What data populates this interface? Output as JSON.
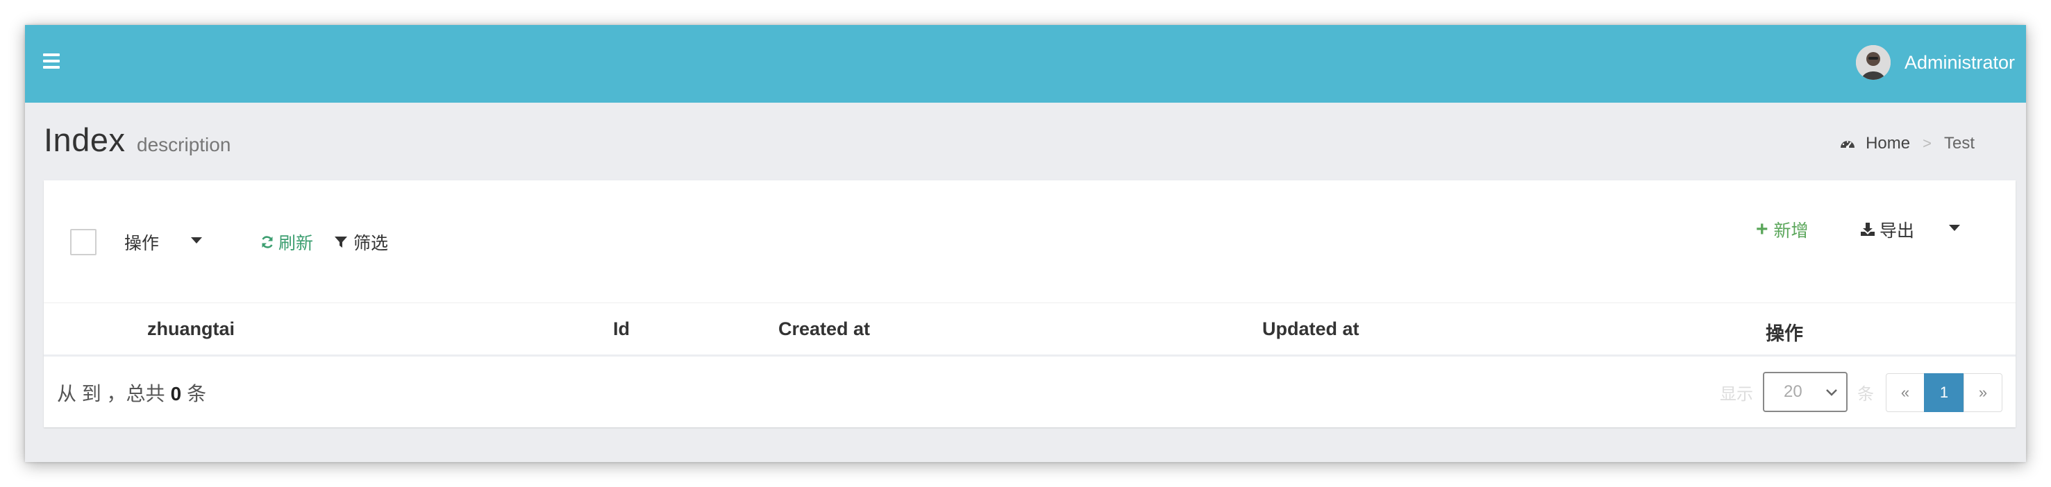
{
  "navbar": {
    "user_name": "Administrator",
    "brand_color": "#4fb8d1"
  },
  "header": {
    "title": "Index",
    "description": "description",
    "breadcrumb": {
      "home_label": "Home",
      "separator": ">",
      "current_label": "Test"
    }
  },
  "toolbar": {
    "action_label": "操作",
    "refresh_label": "刷新",
    "filter_label": "筛选",
    "new_label": "新增",
    "export_label": "导出"
  },
  "table": {
    "columns": [
      "zhuangtai",
      "Id",
      "Created at",
      "Updated at",
      "操作"
    ],
    "rows": []
  },
  "footer": {
    "summary_prefix": "从 到 ，总共",
    "total": "0",
    "summary_suffix": "条",
    "per_page_prefix": "显示",
    "per_page_value": "20",
    "per_page_suffix": "条",
    "pagination": {
      "prev": "«",
      "current": "1",
      "next": "»"
    }
  },
  "colors": {
    "accent_green": "#3c9e70",
    "new_green": "#5aa65a",
    "page_active": "#3c8dbc"
  },
  "icons": [
    "menu-icon",
    "user-avatar",
    "dashboard-icon",
    "caret-down-icon",
    "refresh-icon",
    "filter-icon",
    "plus-icon",
    "download-icon",
    "chevron-down-icon"
  ]
}
